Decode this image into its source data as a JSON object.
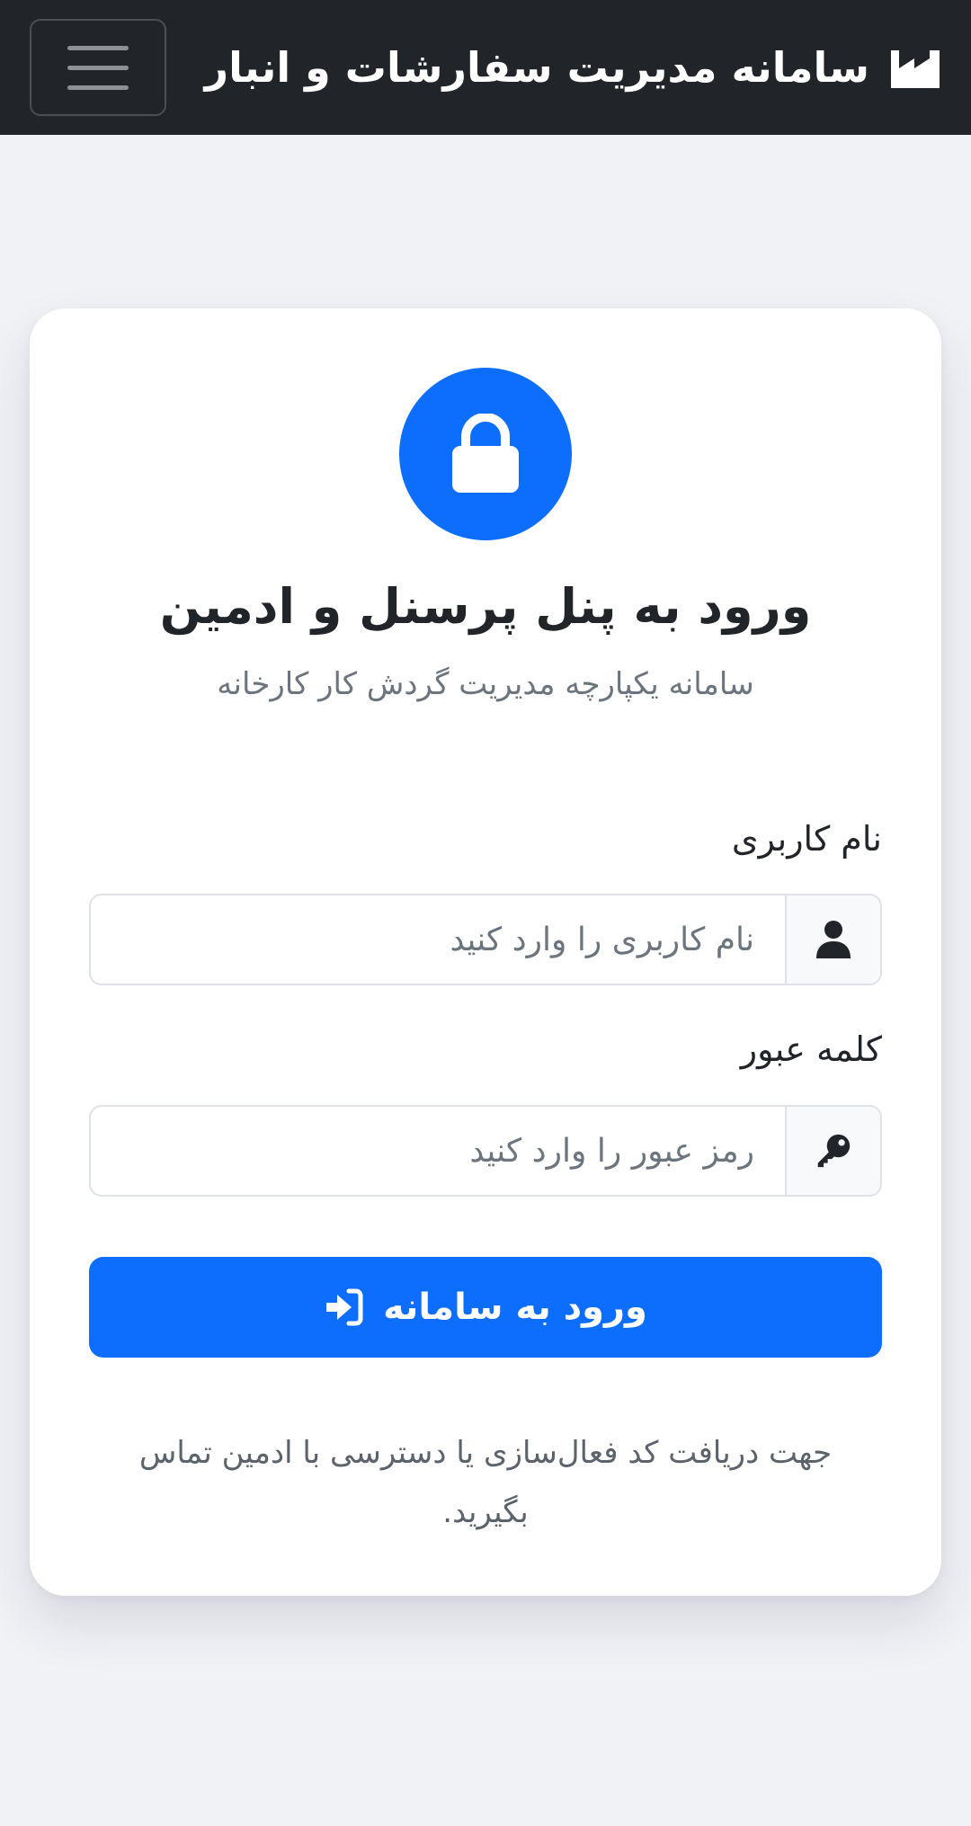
{
  "navbar": {
    "brand_title": "سامانه مدیریت سفارشات و انبار",
    "brand_icon": "factory-icon",
    "menu_icon": "hamburger-menu-icon"
  },
  "login": {
    "title": "ورود به پنل پرسنل و ادمین",
    "subtitle": "سامانه یکپارچه مدیریت گردش کار کارخانه",
    "username": {
      "label": "نام کاربری",
      "placeholder": "نام کاربری را وارد کنید",
      "value": "",
      "icon": "user-icon"
    },
    "password": {
      "label": "کلمه عبور",
      "placeholder": "رمز عبور را وارد کنید",
      "value": "",
      "icon": "key-icon"
    },
    "submit_label": "ورود به سامانه",
    "submit_icon": "sign-in-icon",
    "help_text": "جهت دریافت کد فعال‌سازی یا دسترسی با ادمین تماس بگیرید."
  },
  "colors": {
    "navbar_bg": "#212529",
    "primary": "#0d6efd",
    "page_bg": "#f1f2f6",
    "card_bg": "#ffffff"
  }
}
